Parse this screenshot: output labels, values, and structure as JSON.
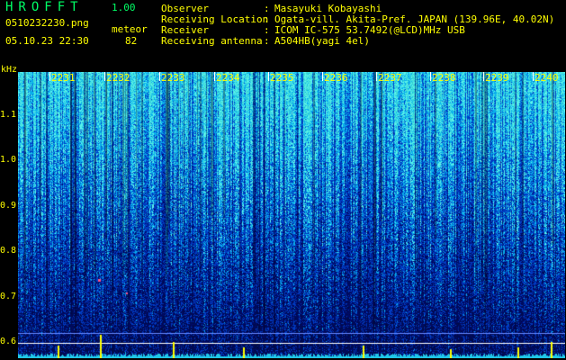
{
  "app": {
    "name": "HROFFT",
    "version": "1.00",
    "file_name": "0510232230.png",
    "date_time": "05.10.23 22:30",
    "mode_label": "meteor",
    "count": "82"
  },
  "info": [
    {
      "label": "Observer",
      "value": "Masayuki Kobayashi"
    },
    {
      "label": "Receiving Location",
      "value": "Ogata-vill. Akita-Pref. JAPAN (139.96E, 40.02N)"
    },
    {
      "label": "Receiver",
      "value": "ICOM IC-575 53.7492(@LCD)MHz USB"
    },
    {
      "label": "Receiving antenna",
      "value": "A504HB(yagi 4el)"
    }
  ],
  "axis": {
    "unit": "kHz",
    "freq_ticks": [
      "1.1",
      "1.0",
      "0.9",
      "0.8",
      "0.7",
      "0.6"
    ],
    "time_ticks": [
      "2231",
      "2232",
      "2233",
      "2234",
      "2235",
      "2236",
      "2237",
      "2238",
      "2239",
      "2240"
    ]
  },
  "colors": {
    "background": "#000000",
    "text": "#ffff00",
    "title": "#00ff66",
    "spectrum_low": "#00105a",
    "spectrum_high": "#33ccdd",
    "burst": "#ffff00"
  }
}
